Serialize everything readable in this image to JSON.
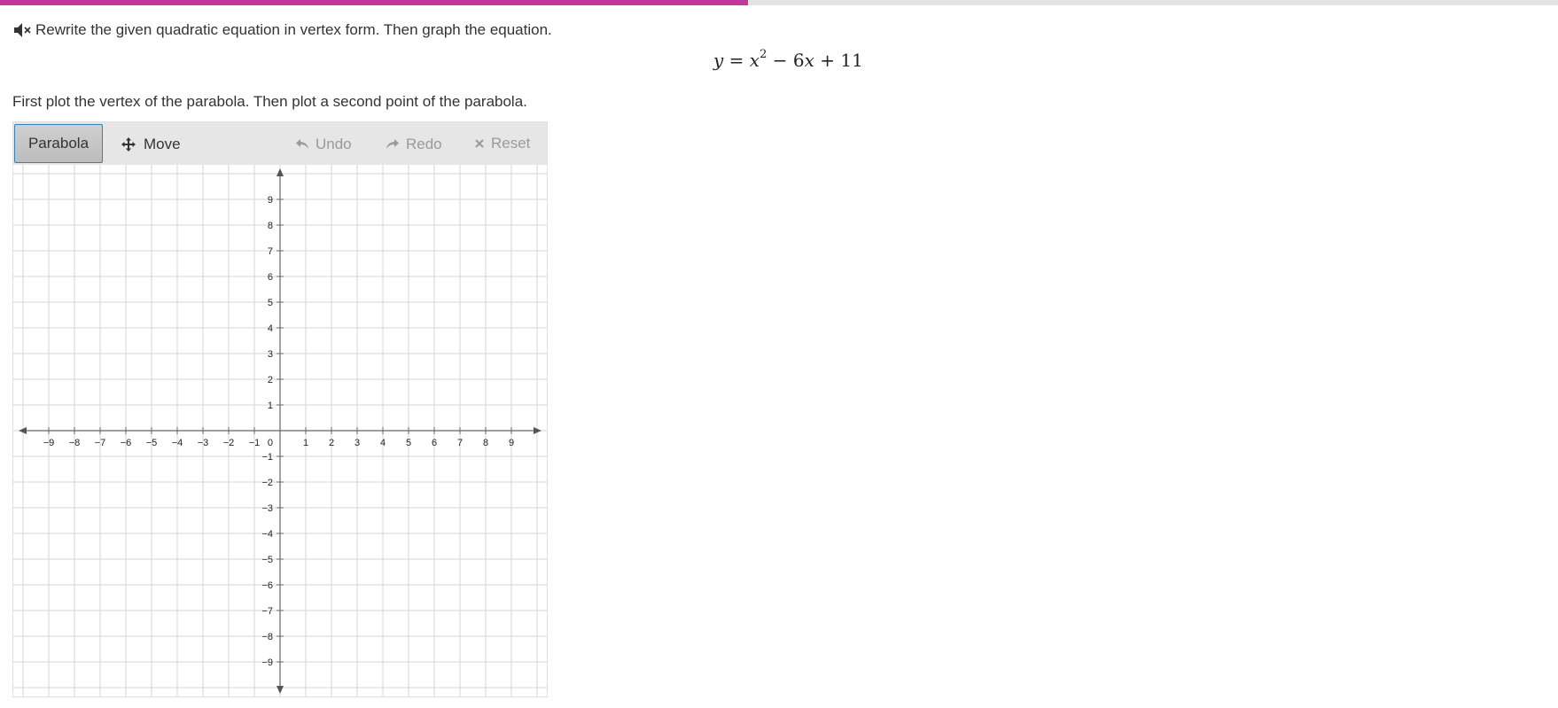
{
  "progress": {
    "fraction": 0.48,
    "color": "#c0399a"
  },
  "prompt": {
    "text": "Rewrite the given quadratic equation in vertex form. Then graph the equation.",
    "audio_icon": "speaker-muted-icon"
  },
  "equation": {
    "lhs": "y",
    "eq": "=",
    "base": "x",
    "exp": "2",
    "rest_op1": "−",
    "rest_coef": "6",
    "rest_var": "x",
    "rest_op2": "+",
    "const": "11"
  },
  "instruction": "First plot the vertex of the parabola. Then plot a second point of the parabola.",
  "toolbar": {
    "parabola_label": "Parabola",
    "move_label": "Move",
    "undo_label": "Undo",
    "redo_label": "Redo",
    "reset_label": "Reset",
    "icons": {
      "move": "move-arrows-icon",
      "undo": "undo-arrow-icon",
      "redo": "redo-arrow-icon",
      "reset": "close-icon"
    }
  },
  "chart_data": {
    "type": "scatter",
    "xlim": [
      -10,
      10
    ],
    "ylim": [
      -10,
      10
    ],
    "x_ticks": [
      -9,
      -8,
      -7,
      -6,
      -5,
      -4,
      -3,
      -2,
      -1,
      1,
      2,
      3,
      4,
      5,
      6,
      7,
      8,
      9
    ],
    "y_ticks": [
      9,
      8,
      7,
      6,
      5,
      4,
      3,
      2,
      1,
      -1,
      -2,
      -3,
      -4,
      -5,
      -6,
      -7,
      -8,
      -9
    ],
    "origin_label": "0",
    "grid": true,
    "points": []
  }
}
